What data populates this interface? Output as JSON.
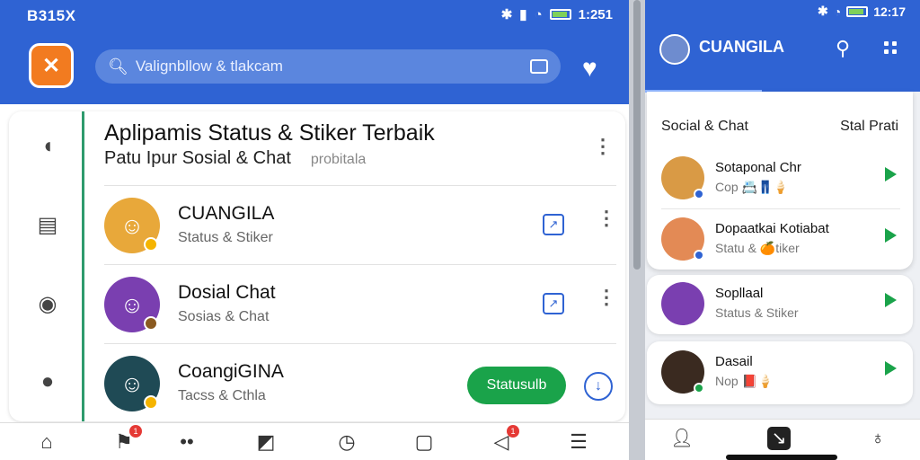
{
  "left_phone": {
    "status": {
      "time": "B315X",
      "clock": "1:251"
    },
    "search": {
      "placeholder": "Valignbllow & tlakcam"
    },
    "card": {
      "title": "Aplipamis Status & Stiker Terbaik",
      "subtitle": "Patu Ipur Sosial & Chat",
      "subtitle_faint": "probitala"
    },
    "rows": [
      {
        "name": "CUANGILA",
        "desc": "Status & Stiker"
      },
      {
        "name": "Dosial Chat",
        "desc": "Sosias & Chat"
      },
      {
        "name": "CoangiGINA",
        "desc": "Tacss & Cthla",
        "button": "Statusulb"
      }
    ],
    "nav": {
      "badge_count": "1"
    }
  },
  "right_phone": {
    "status": {
      "clock": "12:17"
    },
    "title": "CUANGILA",
    "card": {
      "left_heading": "Social & Chat",
      "right_heading": "Stal Prati"
    },
    "rows": [
      {
        "name": "Sotaponal Chr",
        "desc": "Cop 📇👖🍦"
      },
      {
        "name": "Dopaatkai Kotiabat",
        "desc": "Statu & 🍊tiker"
      },
      {
        "name": "Sopllaal",
        "desc": "Status & Stiker"
      },
      {
        "name": "Dasail",
        "desc": "Nop 📕🍦"
      }
    ]
  },
  "colors": {
    "brand_blue": "#2f63d3",
    "accent_green": "#1aa34a",
    "logo_orange": "#f27b20"
  }
}
